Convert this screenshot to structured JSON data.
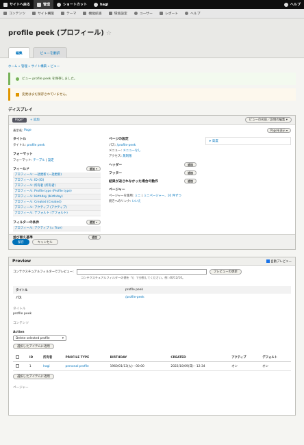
{
  "toolbar": {
    "back_to_site": "サイトへ戻る",
    "manage": "管理",
    "shortcuts": "ショートカット",
    "user": "hagi",
    "help": "ヘルプ"
  },
  "admin_menu": [
    "コンテンツ",
    "サイト構築",
    "テーマ",
    "機能拡張",
    "環境設定",
    "ユーザー",
    "レポート",
    "ヘルプ"
  ],
  "page": {
    "title": "profile peek (プロフィール)",
    "tabs": [
      "編集",
      "ビューを翻訳"
    ],
    "breadcrumb": "ホーム » 管理 » サイト構築 » ビュー"
  },
  "messages": {
    "status": "ビュー profile peek を保存しました。",
    "warning": "変更はまだ保存されていません。"
  },
  "displays": {
    "section_title": "ディスプレイ",
    "active_display": "Page*",
    "add_label": "+ 追加",
    "edit_view_button": "ビューの名前／説明の編集",
    "display_name_label": "表示名:",
    "display_name_value": "Page",
    "show_page_button": "Pageを表示"
  },
  "left_col": {
    "title_heading": "タイトル",
    "title_label": "タイトル:",
    "title_value": "profile peek",
    "format_heading": "フォーマット",
    "format_label": "フォーマット:",
    "format_value": "テーブル",
    "format_settings": "設定",
    "fields_heading": "フィールド",
    "add_button": "追加",
    "fields": [
      "プロフィール: 一括更新 (一括更新)",
      "プロフィール: ID (ID)",
      "プロフィール: 所有者 (所有者)",
      "プロフィール: Profile type (Profile type)",
      "プロフィール: birthday (birthday)",
      "プロフィール: Created (Created)",
      "プロフィール: アクティブ (アクティブ)",
      "プロフィール: デフォルト (デフォルト)"
    ],
    "filter_heading": "フィルターの条件",
    "filters": [
      "プロフィール: アクティブ (= True)"
    ],
    "sort_heading": "並び替え基準"
  },
  "mid_col": {
    "page_settings_heading": "ページの設定",
    "path_label": "パス:",
    "path_value": "/profile-peek",
    "menu_label": "メニュー:",
    "menu_value": "メニューなし",
    "access_label": "アクセス:",
    "access_value": "無制限",
    "header_heading": "ヘッダー",
    "footer_heading": "フッター",
    "no_results_heading": "結果が返されなかった場合の動作",
    "pager_heading": "ページャー",
    "pager_label": "ページャーを使用:",
    "pager_value": "ミニ",
    "pager_sep": "|",
    "pager_items": "ミニページャー、10 件ずつ",
    "more_link_label": "続きへのリンク:",
    "more_link_value": "いいえ"
  },
  "advanced": "▸ 高度",
  "actions": {
    "save": "保存",
    "cancel": "キャンセル"
  },
  "preview": {
    "heading": "Preview",
    "auto_preview": "自動プレビュー",
    "filter_label": "コンテクスチュアルフィルターでプレビュー:",
    "update_button": "プレビューの更新",
    "hint": "コンテクスチュアルフィルターの値を「/」で分割してください。例: 40/12/10。",
    "info_rows": [
      {
        "label": "タイトル",
        "value": "profile peek"
      },
      {
        "label": "パス",
        "value": "/profile-peek"
      }
    ],
    "title_caption": "タイトル",
    "title_value": "profile peek",
    "content_caption": "コンテンツ",
    "action_label": "Action",
    "action_select": "Delete selected profile",
    "apply_button": "選択したアイテムに適用",
    "table_headers": [
      "",
      "ID",
      "所有者",
      "PROFILE TYPE",
      "BIRTHDAY",
      "CREATED",
      "アクティブ",
      "デフォルト"
    ],
    "rows": [
      {
        "id": "1",
        "owner": "hagi",
        "type": "personal profile",
        "birthday": "1960/01/13(火) - 00:00",
        "created": "2022/10/09(日) - 12:34",
        "active": "オン",
        "default": "オン"
      }
    ],
    "pager_caption": "ページャー"
  }
}
